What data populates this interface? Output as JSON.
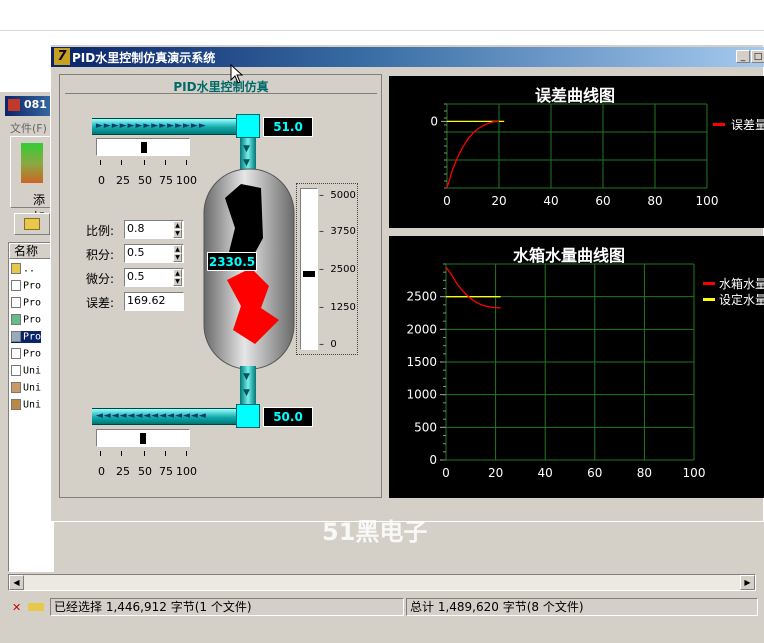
{
  "app": {
    "title": "PID水里控制仿真演示系统",
    "panel_title": "PID水里控制仿真",
    "logo_mark": "7"
  },
  "background": {
    "title_text": "081",
    "menu_file": "文件(F)",
    "add_label": "添加",
    "list_header": "名称",
    "list_items": [
      "..",
      "Pro",
      "Pro",
      "Pro",
      "Pro",
      "Pro",
      "Uni",
      "Uni",
      "Uni"
    ],
    "status_left": "已经选择 1,446,912 字节(1 个文件)",
    "status_right": "总计 1,489,620 字节(8 个文件)"
  },
  "controls": {
    "inflow_value": "51.0",
    "outflow_value": "50.0",
    "inflow_slider": 0.51,
    "outflow_slider": 0.5,
    "slider_ticks": [
      "0",
      "25",
      "50",
      "75",
      "100"
    ],
    "kp_label": "比例:",
    "kp_value": "0.8",
    "ki_label": "积分:",
    "ki_value": "0.5",
    "kd_label": "微分:",
    "kd_value": "0.5",
    "err_label": "误差:",
    "err_value": "169.62",
    "tank_value": "2330.5",
    "tank_fill_fraction": 0.466,
    "gauge_ticks": [
      "5000",
      "3750",
      "2500",
      "1250",
      "0"
    ],
    "gauge_value": 2330.5
  },
  "chart_data": [
    {
      "type": "line",
      "title": "误差曲线图",
      "xlim": [
        0,
        100
      ],
      "x_ticks": [
        "0",
        "20",
        "40",
        "60",
        "80",
        "100"
      ],
      "y_ticks": [
        "0"
      ],
      "series": [
        {
          "name": "误差量",
          "color": "#ff0000",
          "x": [
            0,
            2,
            4,
            6,
            8,
            10,
            12,
            14,
            16,
            18,
            20
          ],
          "y": [
            -2300,
            -1700,
            -1250,
            -900,
            -620,
            -400,
            -250,
            -140,
            -60,
            -10,
            0
          ]
        },
        {
          "name": "",
          "color": "#ffff00",
          "x": [
            0,
            22
          ],
          "y": [
            0,
            0
          ]
        }
      ]
    },
    {
      "type": "line",
      "title": "水箱水量曲线图",
      "xlim": [
        0,
        100
      ],
      "ylim": [
        0,
        3000
      ],
      "x_ticks": [
        "0",
        "20",
        "40",
        "60",
        "80",
        "100"
      ],
      "y_ticks": [
        "0",
        "500",
        "1000",
        "1500",
        "2000",
        "2500"
      ],
      "series": [
        {
          "name": "水箱水量",
          "color": "#ff0000",
          "x": [
            0,
            2,
            4,
            6,
            8,
            10,
            12,
            14,
            16,
            18,
            20,
            22
          ],
          "y": [
            2950,
            2850,
            2720,
            2620,
            2540,
            2470,
            2420,
            2380,
            2355,
            2340,
            2332,
            2330
          ]
        },
        {
          "name": "设定水量",
          "color": "#ffff00",
          "x": [
            0,
            22
          ],
          "y": [
            2500,
            2500
          ]
        }
      ]
    }
  ],
  "watermark": "51黑电子"
}
